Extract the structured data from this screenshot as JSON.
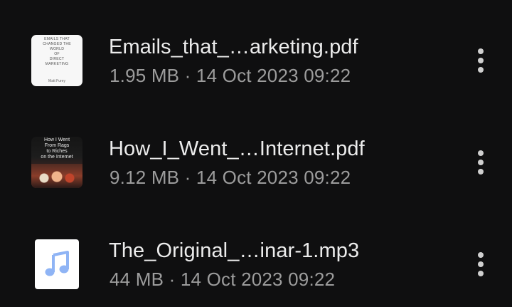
{
  "files": [
    {
      "name": "Emails_that_…arketing.pdf",
      "meta": "1.95 MB · 14 Oct 2023 09:22",
      "thumbnail": {
        "kind": "pdf-cover-light",
        "lines": [
          "EMAILS THAT",
          "CHANGED THE",
          "WORLD",
          "OF",
          "DIRECT",
          "MARKETING"
        ],
        "author": "Matt Furey"
      }
    },
    {
      "name": "How_I_Went_…Internet.pdf",
      "meta": "9.12 MB · 14 Oct 2023 09:22",
      "thumbnail": {
        "kind": "pdf-cover-dark",
        "lines": [
          "How I Went",
          "From Rags",
          "to Riches",
          "on the Internet"
        ]
      }
    },
    {
      "name": "The_Original_…inar-1.mp3",
      "meta": "44 MB · 14 Oct 2023 09:22",
      "thumbnail": {
        "kind": "audio",
        "icon": "music-note-icon",
        "color": "#8fb4f5"
      }
    }
  ],
  "colors": {
    "background": "#0f0f10",
    "name_text": "#ececec",
    "meta_text": "#9c9c9c",
    "more_icon": "#cfcfcf"
  }
}
